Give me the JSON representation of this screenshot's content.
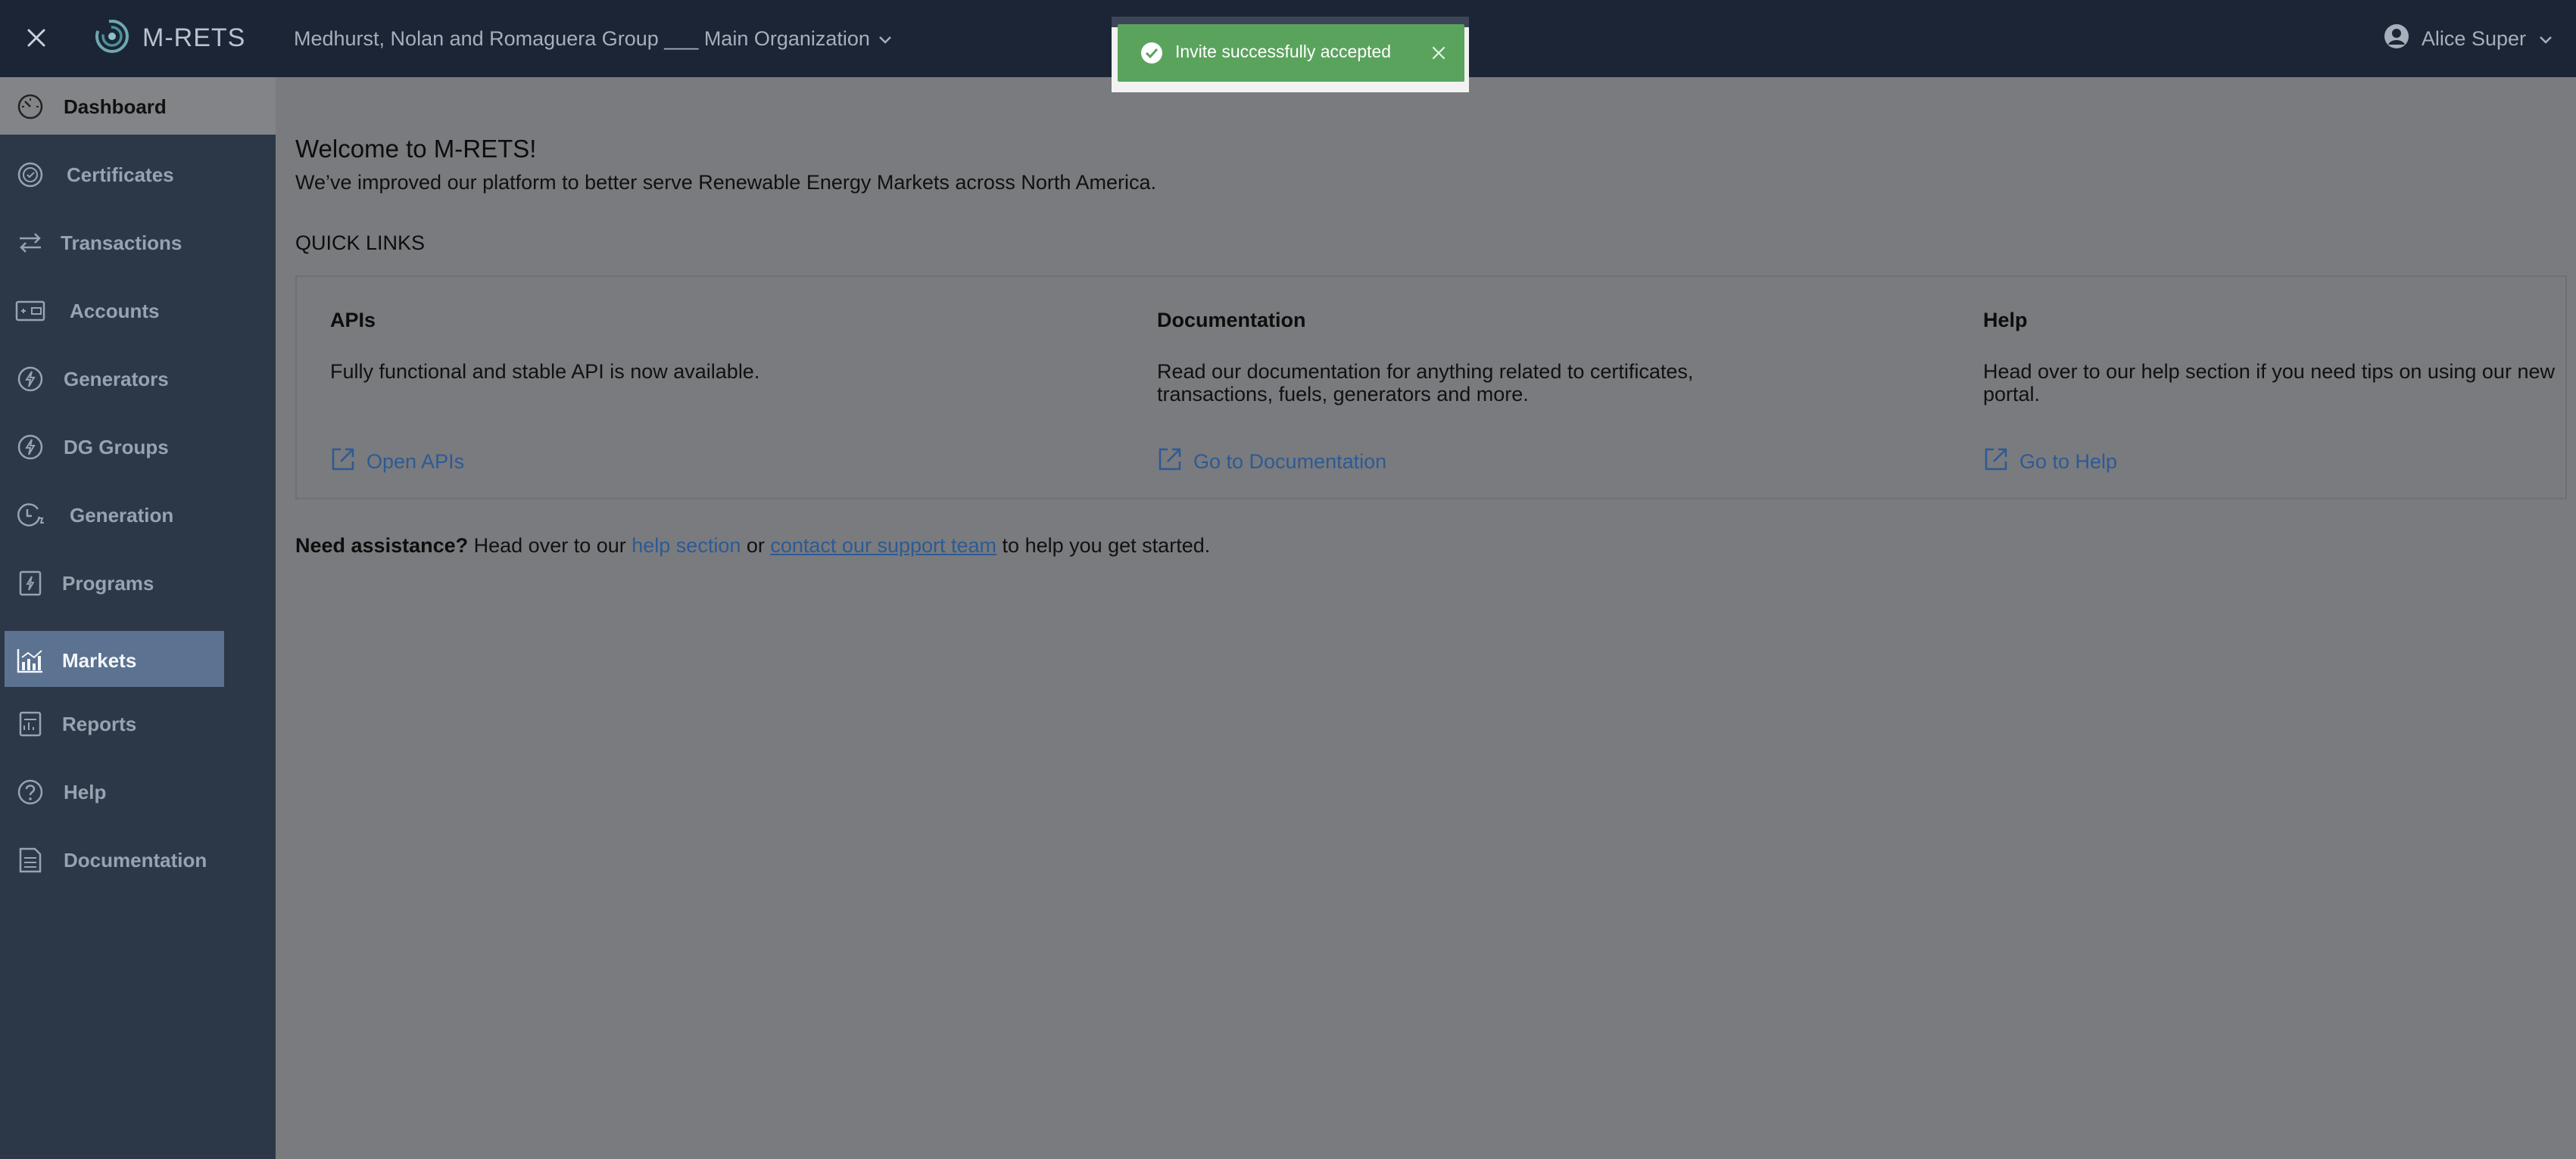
{
  "header": {
    "brand": "M-RETS",
    "organization": "Medhurst, Nolan and Romaguera Group ___ Main Organization",
    "user_name": "Alice Super",
    "icons": [
      "close-icon",
      "brand-logo-icon",
      "chevron-down-icon",
      "user-circle-icon"
    ]
  },
  "sidebar": {
    "items": [
      {
        "label": "Dashboard",
        "icon": "dashboard-gauge-icon"
      },
      {
        "label": "Certificates",
        "icon": "certificate-badge-icon"
      },
      {
        "label": "Transactions",
        "icon": "transfer-arrows-icon"
      },
      {
        "label": "Accounts",
        "icon": "wallet-icon"
      },
      {
        "label": "Generators",
        "icon": "bolt-circle-icon"
      },
      {
        "label": "DG Groups",
        "icon": "bolt-circle-icon"
      },
      {
        "label": "Generation",
        "icon": "generation-clock-icon"
      },
      {
        "label": "Programs",
        "icon": "program-doc-icon"
      },
      {
        "label": "Markets",
        "icon": "market-chart-icon"
      },
      {
        "label": "Reports",
        "icon": "report-doc-icon"
      },
      {
        "label": "Help",
        "icon": "help-circle-icon"
      },
      {
        "label": "Documentation",
        "icon": "documentation-icon"
      }
    ]
  },
  "main": {
    "welcome_title": "Welcome to M-RETS!",
    "welcome_sub": "We’ve improved our platform to better serve Renewable Energy Markets across North America.",
    "quick_links_title": "QUICK LINKS",
    "quick_links": [
      {
        "heading": "APIs",
        "desc_line1": "Fully functional and stable API is now available.",
        "desc_line2": "",
        "link": "Open APIs"
      },
      {
        "heading": "Documentation",
        "desc_line1": "Read our documentation for anything related to certificates,",
        "desc_line2": "transactions, fuels, generators and more.",
        "link": "Go to Documentation"
      },
      {
        "heading": "Help",
        "desc_line1": "Head over to our help section if you need tips on using our new",
        "desc_line2": "portal.",
        "link": "Go to Help"
      }
    ],
    "assist": {
      "bold": "Need assistance?",
      "text1": " Head over to our ",
      "link1": "help section",
      "text2": " or ",
      "link2": "contact our support team",
      "text3": " to help you get started."
    }
  },
  "toast": {
    "message": "Invite successfully accepted",
    "color": "#5aa35d"
  },
  "colors": {
    "topbar": "#1b2535",
    "sidebar": "#2c3848",
    "active_item": "#5b7290",
    "link": "#2d5a94"
  }
}
